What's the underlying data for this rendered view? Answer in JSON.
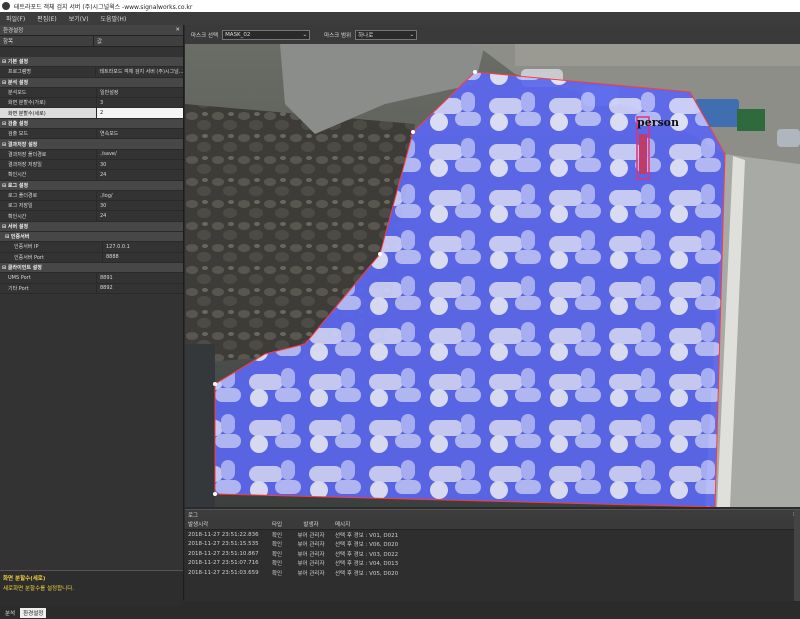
{
  "window": {
    "title": "테트라포드 객체 검지 서버 (주)시그널웍스 -www.signalworks.co.kr"
  },
  "menu": [
    "파일(F)",
    "편집(E)",
    "보기(V)",
    "도움말(H)"
  ],
  "properties_panel": {
    "title": "환경설정",
    "col_item": "항목",
    "col_value": "값",
    "rows": [
      {
        "type": "cat",
        "k": "⊟ 기본 설정",
        "v": ""
      },
      {
        "type": "sub",
        "k": "프로그램명",
        "v": "테트라포드 객체 검지 서버 (주)시그널..."
      },
      {
        "type": "cat",
        "k": "⊟ 분석 설정",
        "v": ""
      },
      {
        "type": "sub",
        "k": "분석모드",
        "v": "일반설정"
      },
      {
        "type": "sub",
        "k": "화면 분할수(가로)",
        "v": "3"
      },
      {
        "type": "sel",
        "k": "화면 분할수(세로)",
        "v": "2"
      },
      {
        "type": "cat",
        "k": "⊟ 검출 설정",
        "v": ""
      },
      {
        "type": "sub",
        "k": "검출 모드",
        "v": "연속모드"
      },
      {
        "type": "cat",
        "k": "⊟ 결과저장 설정",
        "v": ""
      },
      {
        "type": "sub",
        "k": "결과저장 폴더경로",
        "v": "./save/"
      },
      {
        "type": "sub",
        "k": "결과저장 저장일",
        "v": "30"
      },
      {
        "type": "sub",
        "k": "확인시간",
        "v": "24"
      },
      {
        "type": "cat",
        "k": "⊟ 로그 설정",
        "v": ""
      },
      {
        "type": "sub",
        "k": "로그 폴더경로",
        "v": "./log/"
      },
      {
        "type": "sub",
        "k": "로그 저장일",
        "v": "30"
      },
      {
        "type": "sub",
        "k": "확인시간",
        "v": "24"
      },
      {
        "type": "cat",
        "k": "⊟ 서버 설정",
        "v": ""
      },
      {
        "type": "cat2",
        "k": "⊟ 인증서버",
        "v": ""
      },
      {
        "type": "subsub",
        "k": "인증서버 IP",
        "v": "127.0.0.1"
      },
      {
        "type": "subsub",
        "k": "인증서버 Port",
        "v": "8888"
      },
      {
        "type": "cat",
        "k": "⊟ 클라이언트 설정",
        "v": ""
      },
      {
        "type": "sub",
        "k": "UMS Port",
        "v": "8891"
      },
      {
        "type": "sub",
        "k": "기타 Port",
        "v": "8892"
      }
    ],
    "description_title": "화면 분할수(세로)",
    "description_text": "세로화면 분할수를 설정합니다."
  },
  "bottom_tabs": [
    "분석",
    "환경설정"
  ],
  "toolbar": {
    "mask_select_label": "마스크 선택",
    "mask_select_value": "MASK_02",
    "mask_range_label": "마스크 범위",
    "mask_range_value": "하나로"
  },
  "view": {
    "detection_label": "person",
    "mask_color": "#3b48ff",
    "box_color": "#e0307a"
  },
  "log_panel": {
    "title": "로그",
    "columns": [
      "발생시각",
      "타입",
      "발생자",
      "메시지"
    ],
    "rows": [
      {
        "time": "2018-11-27 23:51:22.836",
        "type": "확인",
        "who": "뷰어 관리자",
        "msg": "선택 후 경보 : V01, D021"
      },
      {
        "time": "2018-11-27 23:51:15.535",
        "type": "확인",
        "who": "뷰어 관리자",
        "msg": "선택 후 경보 : V06, D020"
      },
      {
        "time": "2018-11-27 23:51:10.867",
        "type": "확인",
        "who": "뷰어 관리자",
        "msg": "선택 후 경보 : V03, D022"
      },
      {
        "time": "2018-11-27 23:51:07.716",
        "type": "확인",
        "who": "뷰어 관리자",
        "msg": "선택 후 경보 : V04, D013"
      },
      {
        "time": "2018-11-27 23:51:03.659",
        "type": "확인",
        "who": "뷰어 관리자",
        "msg": "선택 후 경보 : V05, D020"
      }
    ]
  }
}
